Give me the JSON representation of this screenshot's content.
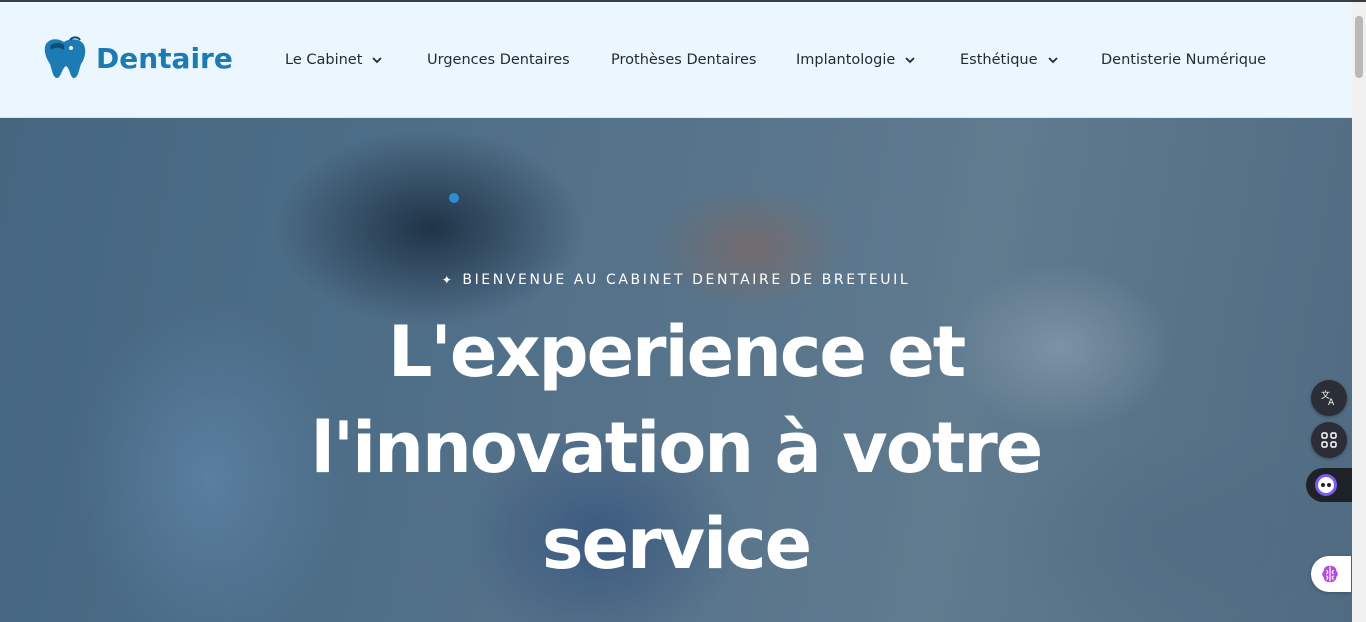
{
  "logo": {
    "text": "Dentaire",
    "icon": "tooth-icon",
    "color": "#1d7bb3"
  },
  "nav": {
    "items": [
      {
        "label": "Le Cabinet",
        "has_dropdown": true
      },
      {
        "label": "Urgences Dentaires",
        "has_dropdown": false
      },
      {
        "label": "Prothèses Dentaires",
        "has_dropdown": false
      },
      {
        "label": "Implantologie",
        "has_dropdown": true
      },
      {
        "label": "Esthétique",
        "has_dropdown": true
      },
      {
        "label": "Dentisterie Numérique",
        "has_dropdown": false
      }
    ]
  },
  "hero": {
    "subtitle": "BIENVENUE AU CABINET DENTAIRE DE BRETEUIL",
    "subtitle_icon": "sparkle-icon",
    "headline_line1": "L'experience et",
    "headline_line2": "l'innovation à votre",
    "headline_line3": "service"
  },
  "side_tools": {
    "translate_icon": "translate-icon",
    "apps_icon": "apps-grid-icon",
    "assistant_icon": "assistant-face-icon",
    "brain_icon": "brain-icon"
  },
  "colors": {
    "header_bg": "#ecf6ff",
    "accent": "#1d7bb3",
    "hero_text": "#ffffff"
  }
}
